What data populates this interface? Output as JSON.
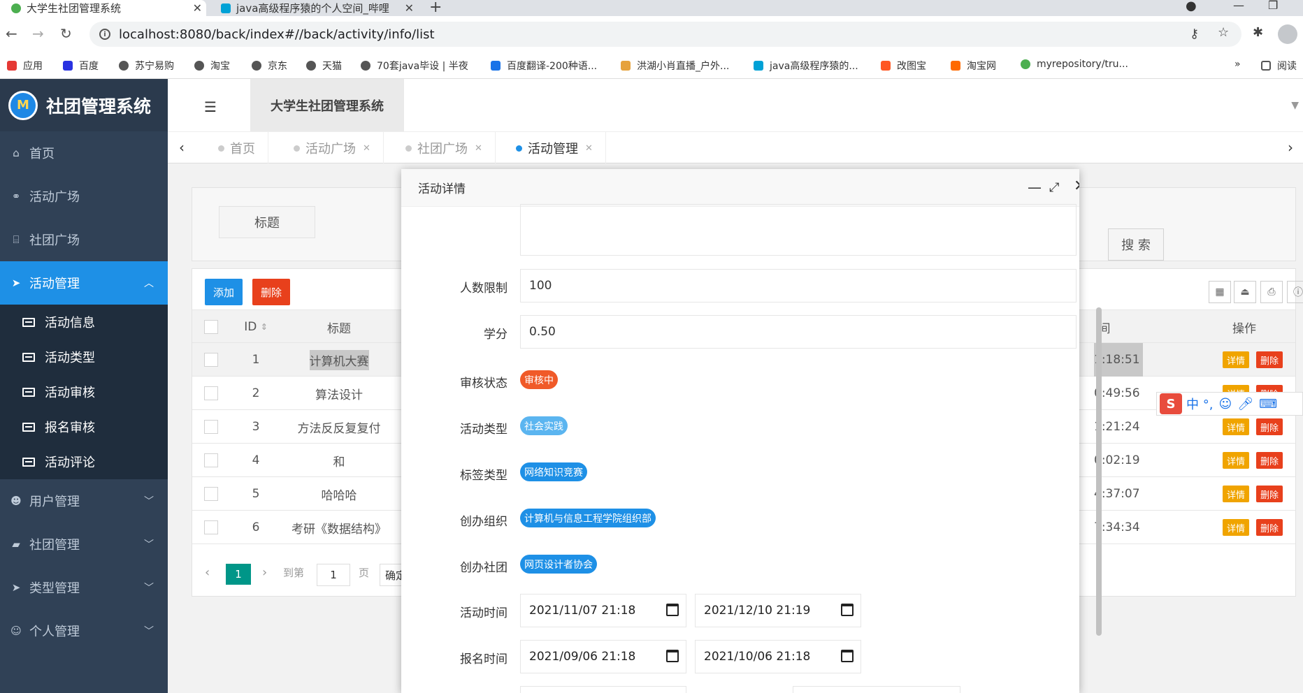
{
  "browser": {
    "tabs": [
      {
        "title": "大学生社团管理系统"
      },
      {
        "title": "java高级程序猿的个人空间_哔哩"
      }
    ],
    "url": "localhost:8080/back/index#//back/activity/info/list",
    "bookmarks": [
      "应用",
      "百度",
      "苏宁易购",
      "淘宝",
      "京东",
      "天猫",
      "70套java毕设 | 半夜",
      "百度翻译-200种语...",
      "洪湖小肖直播_户外...",
      "java高级程序猿的...",
      "改图宝",
      "淘宝网",
      "myrepository/tru...",
      "阅读"
    ]
  },
  "sidebar": {
    "logo": "社团管理系统",
    "items": [
      {
        "label": "首页",
        "icon": "home-icon"
      },
      {
        "label": "活动广场",
        "icon": "motorcycle-icon"
      },
      {
        "label": "社团广场",
        "icon": "bank-icon"
      },
      {
        "label": "活动管理",
        "icon": "paper-plane-icon",
        "active": true
      },
      {
        "label": "用户管理",
        "icon": "users-icon"
      },
      {
        "label": "社团管理",
        "icon": "book-icon"
      },
      {
        "label": "类型管理",
        "icon": "paper-plane-icon"
      },
      {
        "label": "个人管理",
        "icon": "user-icon"
      }
    ],
    "subitems": [
      "活动信息",
      "活动类型",
      "活动审核",
      "报名审核",
      "活动评论"
    ]
  },
  "header": {
    "title": "大学生社团管理系统"
  },
  "pagetabs": [
    "首页",
    "活动广场",
    "社团广场",
    "活动管理"
  ],
  "search": {
    "label": "标题",
    "button": "搜 索"
  },
  "toolbar": {
    "add": "添加",
    "delete": "删除"
  },
  "table": {
    "columns": {
      "id": "ID",
      "title": "标题",
      "time": "间",
      "ops": "操作"
    },
    "rows": [
      {
        "id": "1",
        "title": "计算机大赛",
        "time": "1:18:51"
      },
      {
        "id": "2",
        "title": "算法设计",
        "time": "0:49:56"
      },
      {
        "id": "3",
        "title": "方法反反复复付",
        "time": "1:21:24"
      },
      {
        "id": "4",
        "title": "和",
        "time": "0:02:19"
      },
      {
        "id": "5",
        "title": "哈哈哈",
        "time": "4:37:07"
      },
      {
        "id": "6",
        "title": "考研《数据结构》",
        "time": "7:34:34"
      }
    ],
    "detail_btn": "详情",
    "delete_btn": "删除"
  },
  "pager": {
    "page": "1",
    "goto": "到第",
    "page_input": "1",
    "page_unit": "页",
    "confirm": "确定"
  },
  "ime": {
    "text": "中 °,"
  },
  "modal": {
    "title": "活动详情",
    "fields": {
      "limit": {
        "label": "人数限制",
        "value": "100"
      },
      "credit": {
        "label": "学分",
        "value": "0.50"
      },
      "status": {
        "label": "审核状态",
        "tag": "审核中"
      },
      "type": {
        "label": "活动类型",
        "tag": "社会实践"
      },
      "tagtype": {
        "label": "标签类型",
        "tag": "网络知识竞赛"
      },
      "org": {
        "label": "创办组织",
        "tag": "计算机与信息工程学院组织部"
      },
      "club": {
        "label": "创办社团",
        "tag": "网页设计者协会"
      },
      "acttime": {
        "label": "活动时间",
        "start": "2021/11/07 21:18",
        "end": "2021/12/10 21:19"
      },
      "signtime": {
        "label": "报名时间",
        "start": "2021/09/06 21:18",
        "end": "2021/10/06 21:18"
      }
    }
  },
  "colors": {
    "sidebar": "#304156",
    "active": "#1e90e6",
    "orange": "#f0a400",
    "red": "#e8401c",
    "teal": "#009688",
    "tag_blue": "#1e90e6",
    "tag_light": "#5bb5f0"
  }
}
